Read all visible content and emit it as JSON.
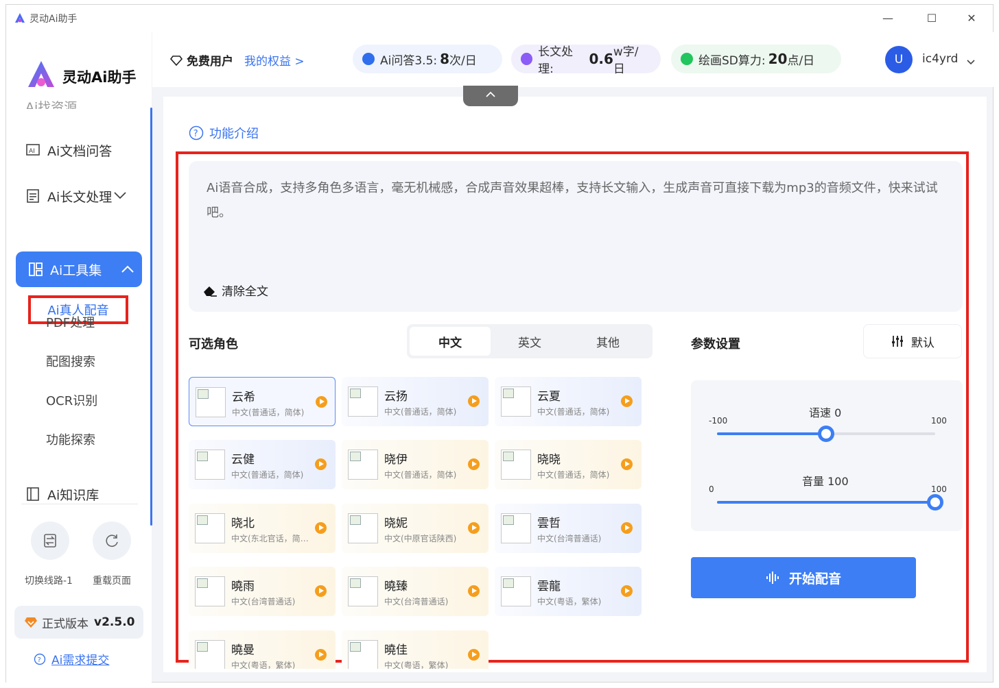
{
  "window": {
    "title": "灵动Ai助手",
    "minimize": "—",
    "maximize": "☐",
    "close": "✕"
  },
  "sidebar": {
    "logo_text": "灵动Ai助手",
    "partial_item": "Ai找资源",
    "items": [
      {
        "label": "Ai文档问答"
      },
      {
        "label": "Ai长文处理"
      },
      {
        "label": "Ai工具集"
      },
      {
        "label": "Ai知识库"
      }
    ],
    "sub_items": [
      {
        "label": "Ai真人配音"
      },
      {
        "label": "PDF处理"
      },
      {
        "label": "配图搜索"
      },
      {
        "label": "OCR识别"
      },
      {
        "label": "功能探索"
      }
    ],
    "switch_route": "切换线路-1",
    "reload_page": "重载页面",
    "version_label": "正式版本",
    "version_number": "v2.5.0",
    "feedback": "Ai需求提交"
  },
  "topbar": {
    "user_type": "免费用户",
    "my_rights": "我的权益 >",
    "quotas": [
      {
        "label": "Ai问答3.5:",
        "value": "8",
        "unit": "次/日",
        "color": "#2f6fed",
        "bg": "#eef3fd"
      },
      {
        "label": "长文处理:",
        "value": "0.6",
        "unit": "w字/日",
        "color": "#8b5cf6",
        "bg": "#f1effc"
      },
      {
        "label": "绘画SD算力:",
        "value": "20",
        "unit": "点/日",
        "color": "#22c55e",
        "bg": "#edf8f0"
      }
    ],
    "avatar_letter": "U",
    "username": "ic4yrd"
  },
  "content": {
    "func_intro": "功能介绍",
    "text": "Ai语音合成，支持多角色多语言，毫无机械感，合成声音效果超棒，支持长文输入，生成声音可直接下载为mp3的音频文件，快来试试吧。",
    "clear_all": "清除全文",
    "roles_title": "可选角色",
    "tabs": [
      "中文",
      "英文",
      "其他"
    ],
    "params_title": "参数设置",
    "default_label": "默认",
    "roles": [
      {
        "name": "云希",
        "desc": "中文(普通话，简体)",
        "style": "sel"
      },
      {
        "name": "云扬",
        "desc": "中文(普通话，简体)",
        "style": "blue"
      },
      {
        "name": "云夏",
        "desc": "中文(普通话，简体)",
        "style": "blue"
      },
      {
        "name": "云健",
        "desc": "中文(普通话，简体)",
        "style": "blue"
      },
      {
        "name": "晓伊",
        "desc": "中文(普通话，简体)",
        "style": "yellow"
      },
      {
        "name": "晓晓",
        "desc": "中文(普通话，简体)",
        "style": "yellow"
      },
      {
        "name": "晓北",
        "desc": "中文(东北官话，简体)",
        "style": "yellow"
      },
      {
        "name": "晓妮",
        "desc": "中文(中原官话陕西)",
        "style": "yellow"
      },
      {
        "name": "雲哲",
        "desc": "中文(台湾普通话)",
        "style": "blue"
      },
      {
        "name": "曉雨",
        "desc": "中文(台湾普通话)",
        "style": "yellow"
      },
      {
        "name": "曉臻",
        "desc": "中文(台湾普通话)",
        "style": "yellow"
      },
      {
        "name": "雲龍",
        "desc": "中文(粤语，繁体)",
        "style": "blue"
      },
      {
        "name": "曉曼",
        "desc": "中文(粤语，繁体)",
        "style": "yellow"
      },
      {
        "name": "曉佳",
        "desc": "中文(粤语，繁体)",
        "style": "yellow"
      }
    ],
    "speed": {
      "label": "语速 0",
      "min": "-100",
      "max": "100",
      "value": 0,
      "range": [
        -100,
        100
      ]
    },
    "volume": {
      "label": "音量 100",
      "min": "0",
      "max": "100",
      "value": 100,
      "range": [
        0,
        100
      ]
    },
    "start_button": "开始配音"
  }
}
